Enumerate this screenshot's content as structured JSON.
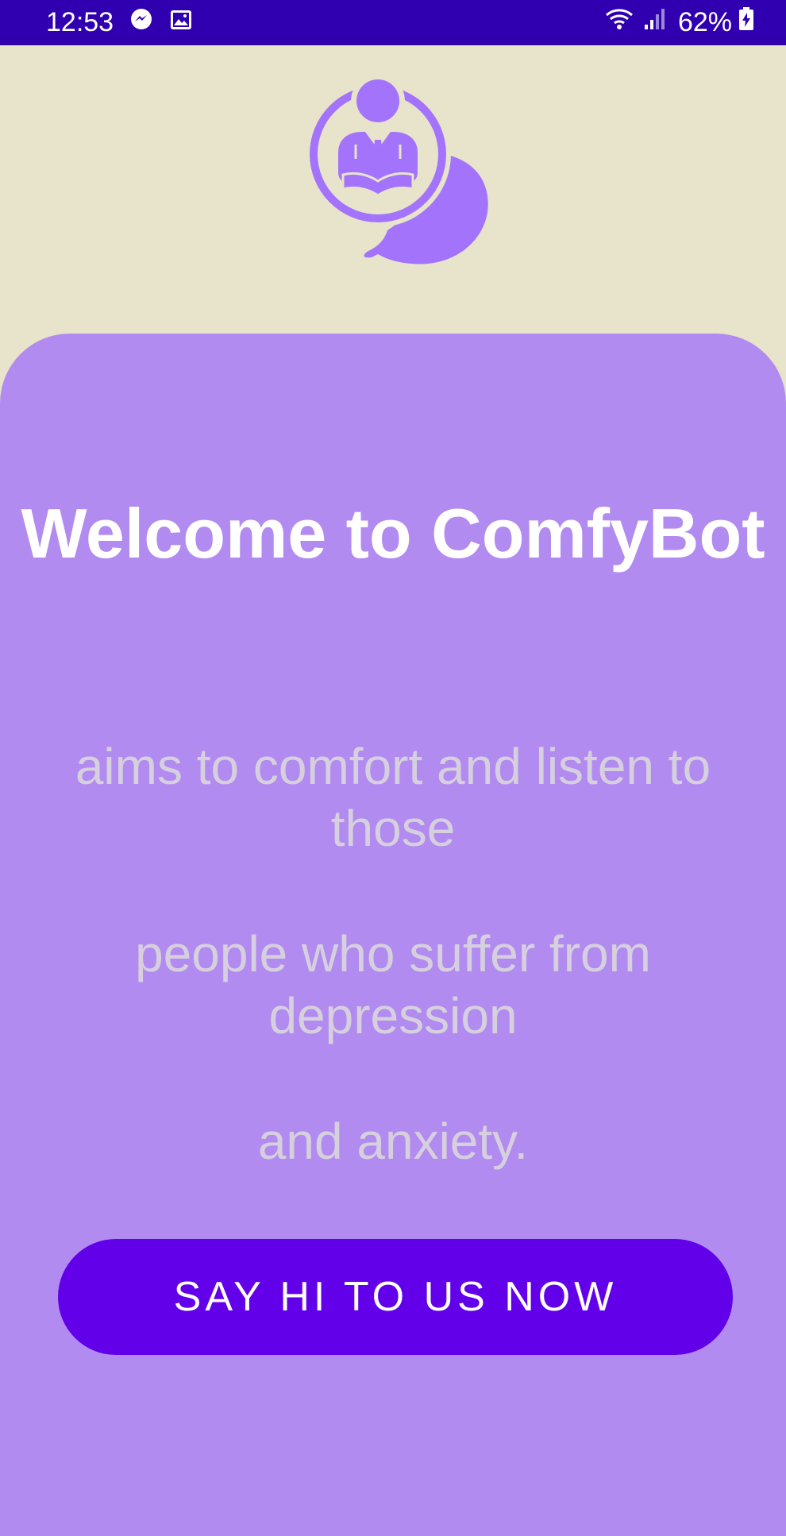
{
  "status_bar": {
    "time": "12:53",
    "battery": "62%",
    "icons": [
      "messenger-icon",
      "gallery-icon",
      "wifi-icon",
      "signal-icon",
      "battery-charging-icon"
    ]
  },
  "colors": {
    "status_bar": "#3000b0",
    "background": "#e8e3cb",
    "card": "#b28bf0",
    "logo": "#a374fb",
    "button": "#6200ea",
    "title_text": "#ffffff",
    "body_text": "#d6d0de"
  },
  "logo": {
    "icon": "chatbot-person-speech-bubble-icon"
  },
  "welcome": {
    "title": "Welcome to ComfyBot",
    "line1": "aims to comfort and listen to those",
    "line2": "people who suffer from depression",
    "line3": "and anxiety."
  },
  "cta": {
    "label": "SAY HI TO US NOW"
  }
}
